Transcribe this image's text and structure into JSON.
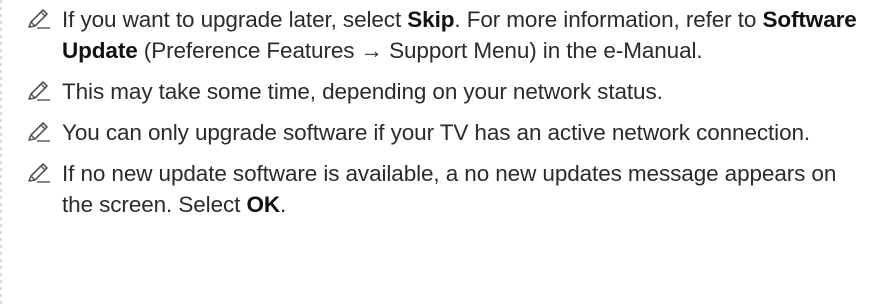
{
  "notes": [
    {
      "icon": "pencil-note-icon",
      "parts": [
        {
          "t": "If you want to upgrade later, select ",
          "b": false
        },
        {
          "t": "Skip",
          "b": true
        },
        {
          "t": ". For more information, refer to ",
          "b": false
        },
        {
          "t": "Software Update",
          "b": true
        },
        {
          "t": " (Preference Features → Support Menu) in the e-Manual.",
          "b": false
        }
      ]
    },
    {
      "icon": "pencil-note-icon",
      "parts": [
        {
          "t": "This may take some time, depending on your network status.",
          "b": false
        }
      ]
    },
    {
      "icon": "pencil-note-icon",
      "parts": [
        {
          "t": "You can only upgrade software if your TV has an active network connection.",
          "b": false
        }
      ]
    },
    {
      "icon": "pencil-note-icon",
      "parts": [
        {
          "t": "If no new update software is available, a no new updates message appears on the screen. Select ",
          "b": false
        },
        {
          "t": "OK",
          "b": true
        },
        {
          "t": ".",
          "b": false
        }
      ]
    }
  ]
}
